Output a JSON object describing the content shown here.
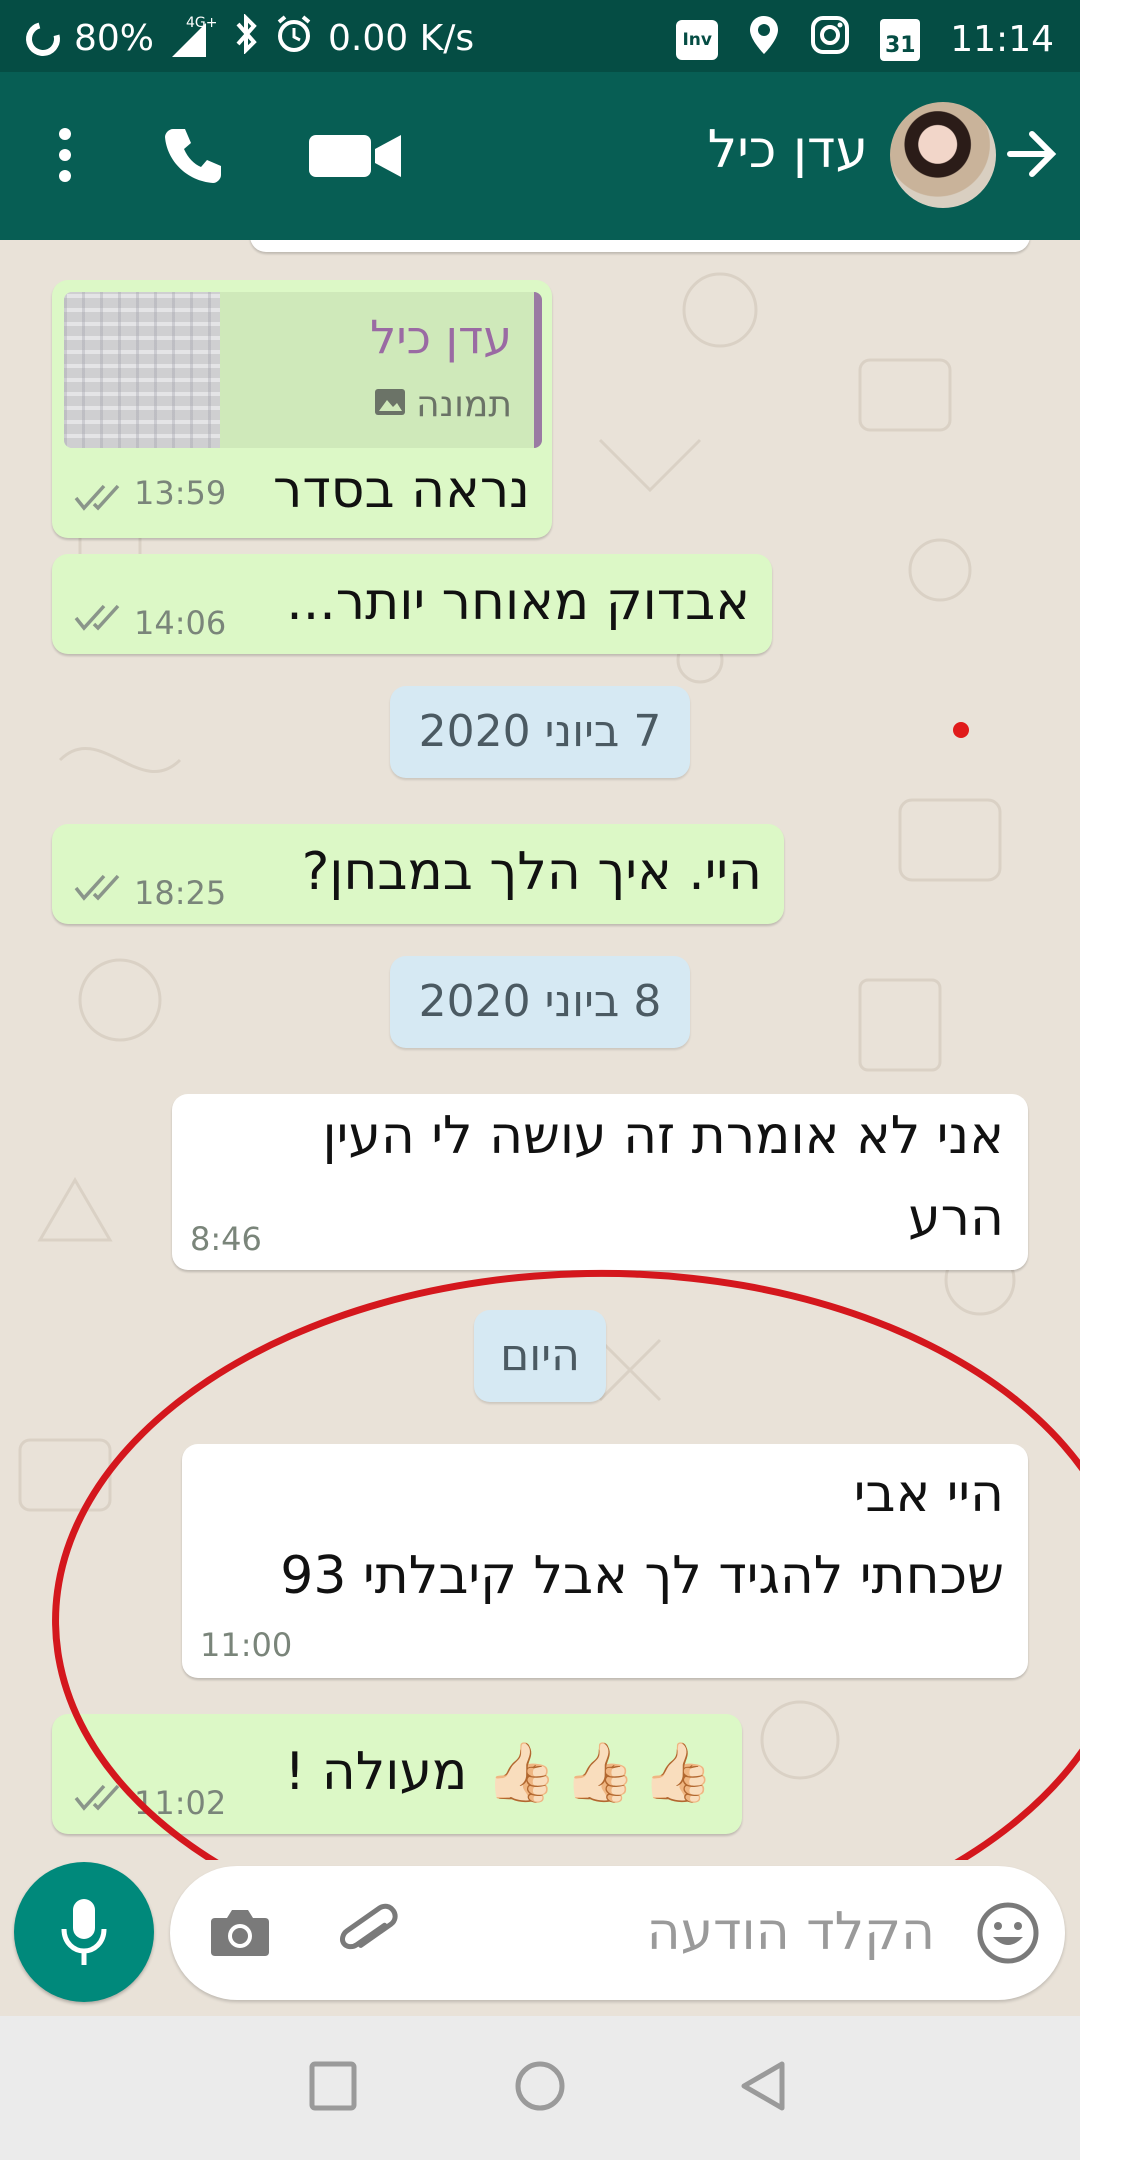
{
  "status_bar": {
    "battery": "80%",
    "network": "4G+",
    "speed": "0.00 K/s",
    "clock": "11:14",
    "calendar_day": "31",
    "app_badge": "Inv"
  },
  "header": {
    "contact_name": "עדן כיל"
  },
  "messages": [
    {
      "type": "outgoing",
      "quote": {
        "sender": "עדן כיל",
        "label": "תמונה"
      },
      "text": "נראה בסדר",
      "time": "13:59"
    },
    {
      "type": "outgoing",
      "text": "אבדוק מאוחר יותר...",
      "time": "14:06"
    },
    {
      "type": "date",
      "text": "7 ביוני 2020"
    },
    {
      "type": "outgoing",
      "text": "היי. איך הלך במבחן?",
      "time": "18:25"
    },
    {
      "type": "date",
      "text": "8 ביוני 2020"
    },
    {
      "type": "incoming",
      "lines": [
        "אני לא אומרת זה עושה לי העין",
        "הרע"
      ],
      "time": "8:46"
    },
    {
      "type": "date",
      "text": "היום"
    },
    {
      "type": "incoming",
      "lines": [
        "היי אבי",
        "שכחתי להגיד לך אבל קיבלתי 93"
      ],
      "time": "11:00"
    },
    {
      "type": "outgoing",
      "text": "מעולה !",
      "emoji": "👍🏻👍🏻👍🏻",
      "time": "11:02"
    }
  ],
  "composer": {
    "placeholder": "הקלד הודעה"
  },
  "colors": {
    "header": "#075e54",
    "status_bar": "#054d44",
    "outgoing_bubble": "#dcf8c6",
    "incoming_bubble": "#ffffff",
    "date_pill": "#d6e9f3",
    "accent": "#00897b",
    "annotation": "#d4171d"
  },
  "icons": [
    "battery-ring-icon",
    "signal-icon",
    "bluetooth-icon",
    "alarm-icon",
    "location-icon",
    "instagram-icon",
    "calendar-icon",
    "more-vert-icon",
    "phone-icon",
    "video-icon",
    "back-arrow-icon",
    "image-icon",
    "double-check-icon",
    "mic-icon",
    "camera-icon",
    "attach-icon",
    "emoji-icon",
    "nav-square-icon",
    "nav-circle-icon",
    "nav-triangle-icon"
  ]
}
